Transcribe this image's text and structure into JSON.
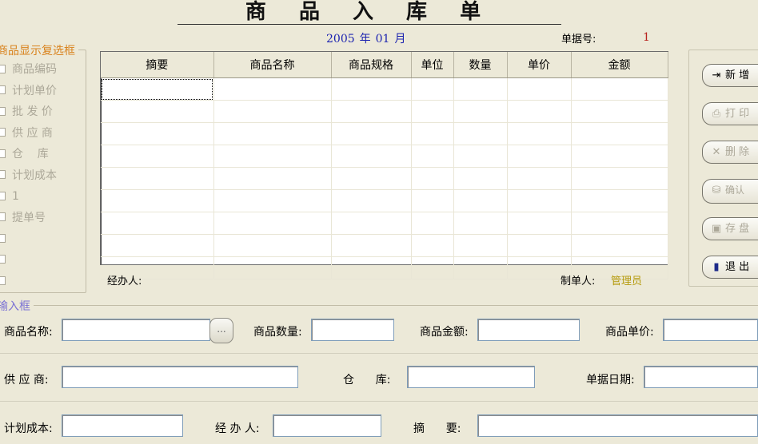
{
  "title": "商 品 入 库 单",
  "date": {
    "year": "2005",
    "year_unit": "年",
    "month": "01",
    "month_unit": "月"
  },
  "bill_no_label": "单据号:",
  "bill_no": "1",
  "display_options": {
    "legend": "商品显示复选框",
    "items": [
      "商品编码",
      "计划单价",
      "批 发 价",
      "供 应 商",
      "仓    库",
      "计划成本",
      "1",
      "提单号",
      "",
      "",
      ""
    ]
  },
  "grid": {
    "columns": [
      "摘要",
      "商品名称",
      "商品规格",
      "单位",
      "数量",
      "单价",
      "金额"
    ],
    "rows": 9
  },
  "footer": {
    "handler_label": "经办人:",
    "maker_label": "制单人:",
    "maker": "管理员"
  },
  "buttons": {
    "new": "新  增",
    "print": "打  印",
    "delete": "删  除",
    "confirm": "确认",
    "save": "存  盘",
    "exit": "退  出"
  },
  "input_box": {
    "legend": "输入框",
    "product_name_label": "商品名称:",
    "quantity_label": "商品数量:",
    "amount_label": "商品金额:",
    "unit_price_label": "商品单价:",
    "supplier_label": "供 应 商:",
    "warehouse_label": "仓      库:",
    "bill_date_label": "单据日期:",
    "plan_cost_label": "计划成本:",
    "handler_label": "经 办 人:",
    "summary_label": "摘      要:",
    "browse_label": "..."
  },
  "colors": {
    "title_blue": "#1d24b0",
    "bill_red": "#b8241f",
    "legend_orange": "#d9831e",
    "legend_purple": "#7a71d4",
    "maker_gold": "#b59a0c"
  }
}
